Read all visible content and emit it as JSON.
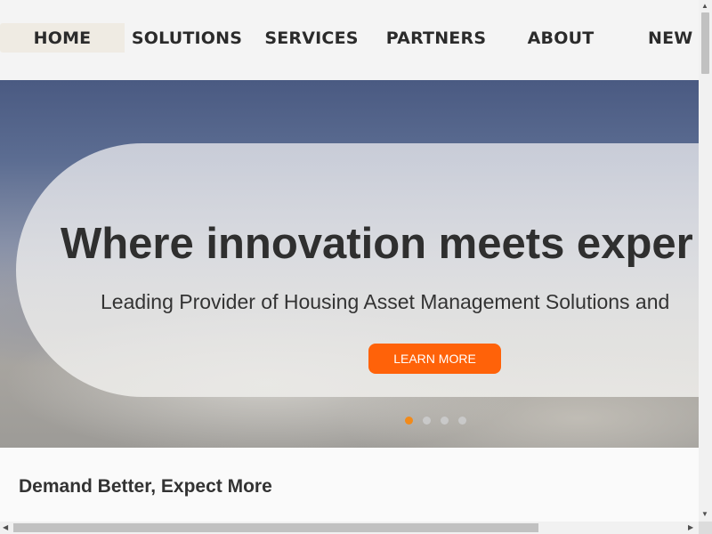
{
  "nav": {
    "items": [
      {
        "label": "HOME",
        "active": true
      },
      {
        "label": "SOLUTIONS"
      },
      {
        "label": "SERVICES"
      },
      {
        "label": "PARTNERS"
      },
      {
        "label": "ABOUT"
      },
      {
        "label": "NEW"
      }
    ]
  },
  "hero": {
    "title": "Where innovation meets exper",
    "subtitle": "Leading Provider of Housing Asset Management Solutions and",
    "cta_label": "LEARN MORE",
    "slide_count": 4,
    "active_slide": 1
  },
  "content": {
    "heading": "Demand Better, Expect More"
  },
  "colors": {
    "accent": "#ff6209",
    "active_dot": "#f28a1a",
    "text": "#2f2f2f"
  },
  "icons": {
    "scroll_up": "triangle-up",
    "scroll_down": "triangle-down",
    "scroll_left": "triangle-left",
    "scroll_right": "triangle-right"
  }
}
